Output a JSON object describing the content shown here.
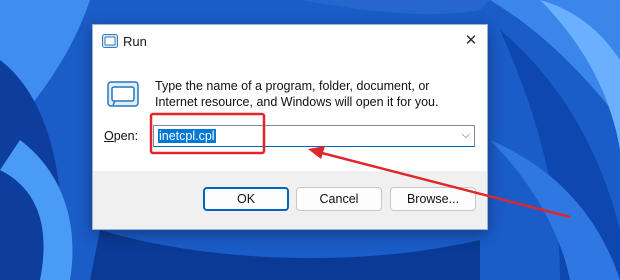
{
  "dialog": {
    "title": "Run",
    "description": "Type the name of a program, folder, document, or Internet resource, and Windows will open it for you.",
    "open_label_accel": "O",
    "open_label_rest": "pen:",
    "open_value": "inetcpl.cpl",
    "close_glyph": "✕",
    "dropdown_glyph": "⌵",
    "buttons": {
      "ok": "OK",
      "cancel": "Cancel",
      "browse": "Browse..."
    }
  },
  "icons": {
    "title": "run-icon",
    "main": "run-icon",
    "close": "close-icon",
    "dropdown": "chevron-down-icon"
  },
  "colors": {
    "wallpaper": "#1c5fc9",
    "selection": "#0078d7",
    "annotation": "#e0262a",
    "ok_border": "#0067c0"
  }
}
